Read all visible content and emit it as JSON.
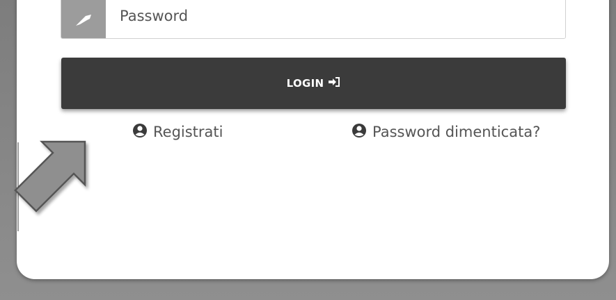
{
  "login_form": {
    "password_placeholder": "Password",
    "login_label": "LOGIN",
    "login_icon": "sign-in-icon",
    "register_label": "Registrati",
    "register_icon": "user-circle-icon",
    "forgot_label": "Password dimenticata?",
    "forgot_icon": "user-circle-icon",
    "password_icon": "key-icon"
  },
  "overlay": {
    "pointer_icon": "arrow-up-right-icon"
  },
  "colors": {
    "backdrop": "#8a8a8a",
    "button": "#3b3b3b",
    "addon": "#9c9c9c",
    "link_text": "#555555"
  }
}
